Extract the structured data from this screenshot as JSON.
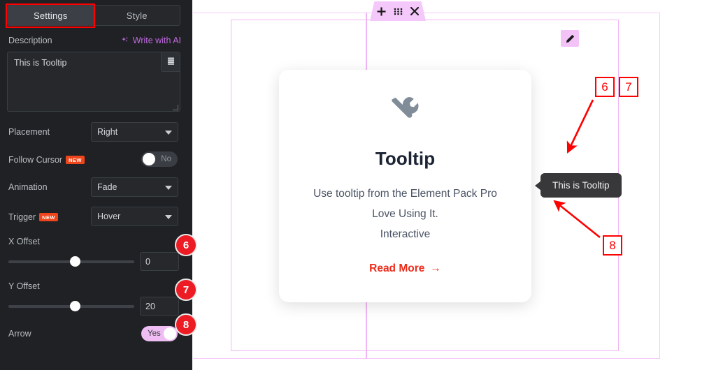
{
  "panel": {
    "tabs": [
      {
        "label": "Settings",
        "active": true,
        "highlighted": true
      },
      {
        "label": "Style",
        "active": false,
        "highlighted": false
      }
    ],
    "description": {
      "label": "Description",
      "ai_link": "Write with AI",
      "value": "This is Tooltip",
      "dynamic_icon": "database-stack-icon"
    },
    "controls": [
      {
        "name": "placement",
        "label": "Placement",
        "type": "select",
        "value": "Right"
      },
      {
        "name": "follow-cursor",
        "label": "Follow Cursor",
        "badge": "NEW",
        "type": "toggle",
        "value": "No",
        "state": "off"
      },
      {
        "name": "animation",
        "label": "Animation",
        "type": "select",
        "value": "Fade"
      },
      {
        "name": "trigger",
        "label": "Trigger",
        "badge": "NEW",
        "type": "select",
        "value": "Hover"
      },
      {
        "name": "x-offset",
        "label": "X Offset",
        "type": "slider",
        "value": "0"
      },
      {
        "name": "y-offset",
        "label": "Y Offset",
        "type": "slider",
        "value": "20"
      },
      {
        "name": "arrow",
        "label": "Arrow",
        "type": "toggle",
        "value": "Yes",
        "state": "on"
      }
    ],
    "collapse_icon": "chevron-left-icon",
    "step_badges": [
      "6",
      "7",
      "8"
    ]
  },
  "canvas": {
    "handle_icons": [
      "plus-icon",
      "drag-dots-icon",
      "close-icon"
    ],
    "edit_icon": "pencil-icon",
    "card": {
      "icon": "tools-icon",
      "title": "Tooltip",
      "description_lines": [
        "Use tooltip from the Element Pack Pro",
        "Love Using It.",
        "Interactive"
      ],
      "link_label": "Read More",
      "link_arrow": "→"
    },
    "tooltip_popup": {
      "text": "This is Tooltip",
      "placement": "right"
    },
    "annotations": [
      {
        "label": "6"
      },
      {
        "label": "7"
      },
      {
        "label": "8"
      }
    ]
  },
  "colors": {
    "panel_bg": "#1f2124",
    "accent_pink": "#f0b6f5",
    "annotation_red": "#ff0000",
    "badge_red": "#ed1c24",
    "link_red": "#ee2b1a",
    "toggle_on": "#efbdf4",
    "new_badge": "#f0441b",
    "ai_purple": "#c06ae0"
  }
}
